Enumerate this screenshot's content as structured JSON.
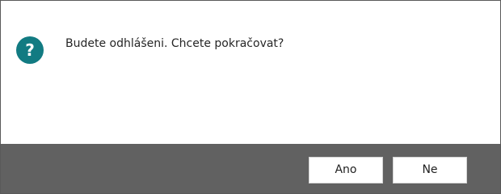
{
  "dialog": {
    "icon": "question-icon",
    "icon_glyph": "?",
    "icon_color": "#127b82",
    "message": "Budete odhlášeni. Chcete pokračovat?",
    "footer_color": "#616161",
    "buttons": {
      "yes_label": "Ano",
      "no_label": "Ne"
    }
  }
}
